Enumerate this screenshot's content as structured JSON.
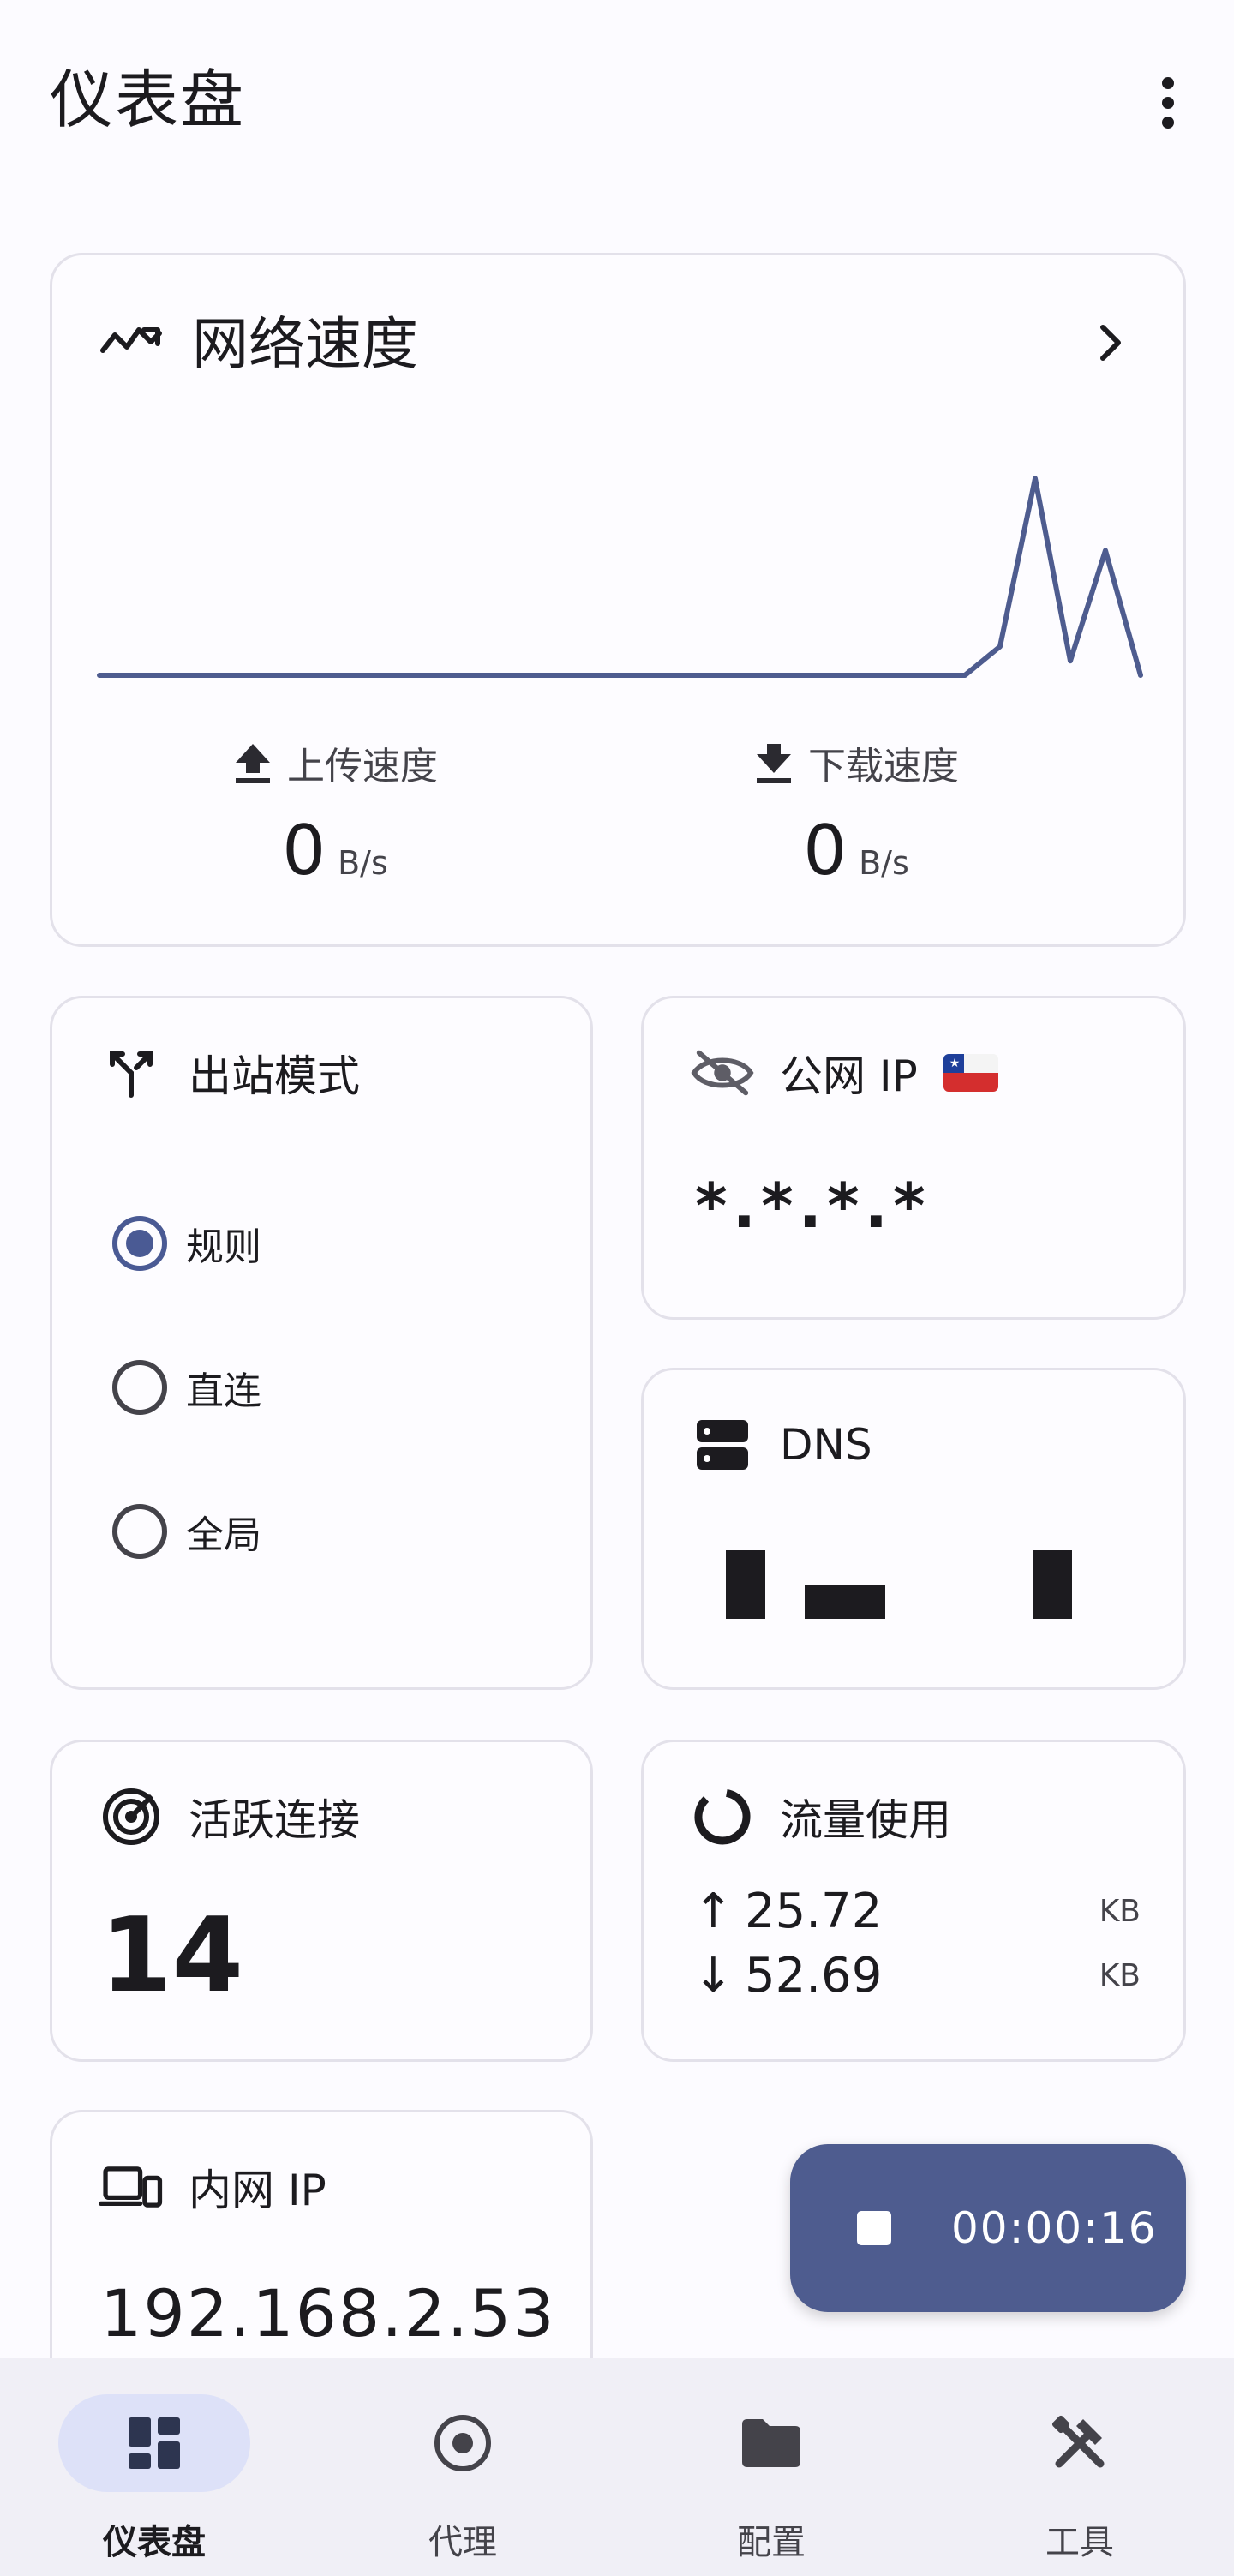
{
  "header": {
    "title": "仪表盘"
  },
  "speed": {
    "title": "网络速度",
    "upload_label": "上传速度",
    "upload_value": "0",
    "upload_unit": "B/s",
    "download_label": "下载速度",
    "download_value": "0",
    "download_unit": "B/s",
    "chart_series": [
      0,
      0,
      0,
      0,
      0,
      0,
      0,
      0,
      0,
      0,
      0,
      0,
      0,
      0,
      0,
      0,
      0,
      0,
      0,
      0,
      0,
      0,
      0.12,
      0.82,
      0.06,
      0.52,
      0
    ]
  },
  "outbound": {
    "title": "出站模式",
    "options": [
      {
        "label": "规则",
        "selected": true
      },
      {
        "label": "直连",
        "selected": false
      },
      {
        "label": "全局",
        "selected": false
      }
    ]
  },
  "public_ip": {
    "title": "公网 IP",
    "value": "*.*.*.*"
  },
  "dns": {
    "title": "DNS"
  },
  "connections": {
    "title": "活跃连接",
    "count": "14"
  },
  "traffic": {
    "title": "流量使用",
    "up_arrow": "↑",
    "up_value": "25.72",
    "up_unit": "KB",
    "down_arrow": "↓",
    "down_value": "52.69",
    "down_unit": "KB"
  },
  "lan_ip": {
    "title": "内网 IP",
    "value": "192.168.2.53"
  },
  "timer": {
    "elapsed": "00:00:16"
  },
  "nav": {
    "items": [
      {
        "label": "仪表盘",
        "active": true
      },
      {
        "label": "代理",
        "active": false
      },
      {
        "label": "配置",
        "active": false
      },
      {
        "label": "工具",
        "active": false
      }
    ]
  },
  "colors": {
    "accent": "#4e5c8f",
    "nav_active_bg": "#dde1f8",
    "nav_bg": "#f0eff6"
  }
}
